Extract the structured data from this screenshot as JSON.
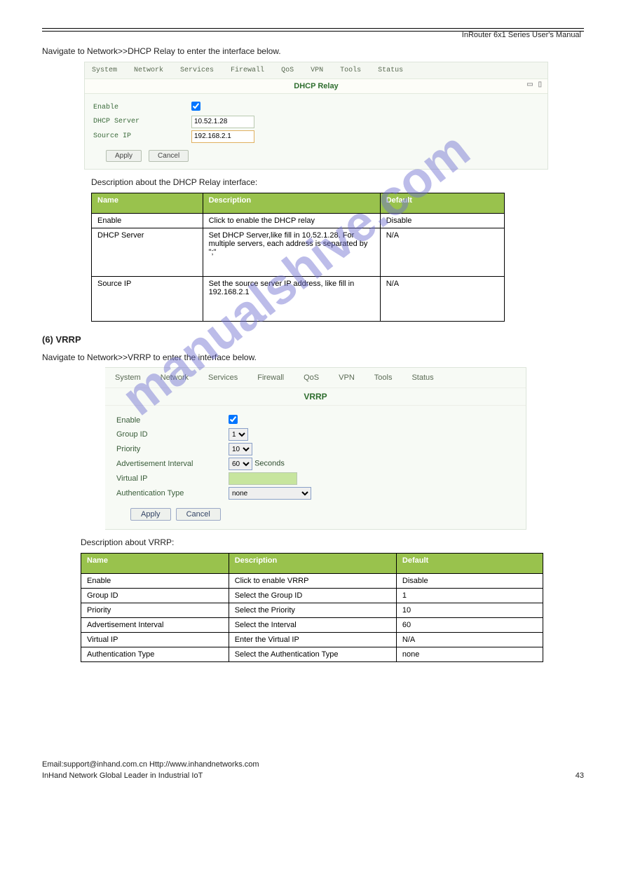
{
  "header": {
    "right": "InRouter 6x1 Series User's Manual"
  },
  "watermark": "manualshive.com",
  "intro": "Navigate to Network>>DHCP Relay to enter the interface below.",
  "shot1": {
    "menu": [
      "System",
      "Network",
      "Services",
      "Firewall",
      "QoS",
      "VPN",
      "Tools",
      "Status"
    ],
    "title": "DHCP Relay",
    "rows": {
      "enable_label": "Enable",
      "server_label": "DHCP Server",
      "server_value": "10.52.1.28",
      "source_label": "Source IP",
      "source_value": "192.168.2.1"
    },
    "apply": "Apply",
    "cancel": "Cancel"
  },
  "table1": {
    "headers": [
      "Name",
      "Description",
      "Default"
    ],
    "rows": [
      [
        "Enable",
        "Click to enable the DHCP relay",
        "Disable"
      ],
      [
        "DHCP Server",
        "Set DHCP Server,like fill in 10.52.1.28. For multiple servers, each address is separated by \";\"",
        "N/A"
      ],
      [
        "Source IP",
        "Set the source server IP address, like fill in 192.168.2.1",
        "N/A"
      ]
    ]
  },
  "section2_head": "(6) VRRP",
  "section2_intro": "Navigate to Network>>VRRP to enter the interface below.",
  "shot2": {
    "menu": [
      "System",
      "Network",
      "Services",
      "Firewall",
      "QoS",
      "VPN",
      "Tools",
      "Status"
    ],
    "title": "VRRP",
    "rows": {
      "enable_label": "Enable",
      "group_label": "Group ID",
      "group_value": "1",
      "priority_label": "Priority",
      "priority_value": "10",
      "adv_label": "Advertisement Interval",
      "adv_value": "60",
      "adv_suffix": "Seconds",
      "vip_label": "Virtual IP",
      "auth_label": "Authentication Type",
      "auth_value": "none"
    },
    "apply": "Apply",
    "cancel": "Cancel"
  },
  "table2": {
    "headers": [
      "Name",
      "Description",
      "Default"
    ],
    "rows": [
      [
        "Enable",
        "Click to enable VRRP",
        "Disable"
      ],
      [
        "Group ID",
        "Select the Group ID",
        "1"
      ],
      [
        "Priority",
        "Select the Priority",
        "10"
      ],
      [
        "Advertisement Interval",
        "Select the Interval",
        "60"
      ],
      [
        "Virtual IP",
        "Enter the Virtual IP",
        "N/A"
      ],
      [
        "Authentication Type",
        "Select the Authentication Type",
        "none"
      ]
    ]
  },
  "footer": {
    "email": "Email:support@inhand.com.cn        Http://www.inhandnetworks.com",
    "brand": "InHand Network Global Leader in Industrial IoT",
    "page": "43"
  }
}
